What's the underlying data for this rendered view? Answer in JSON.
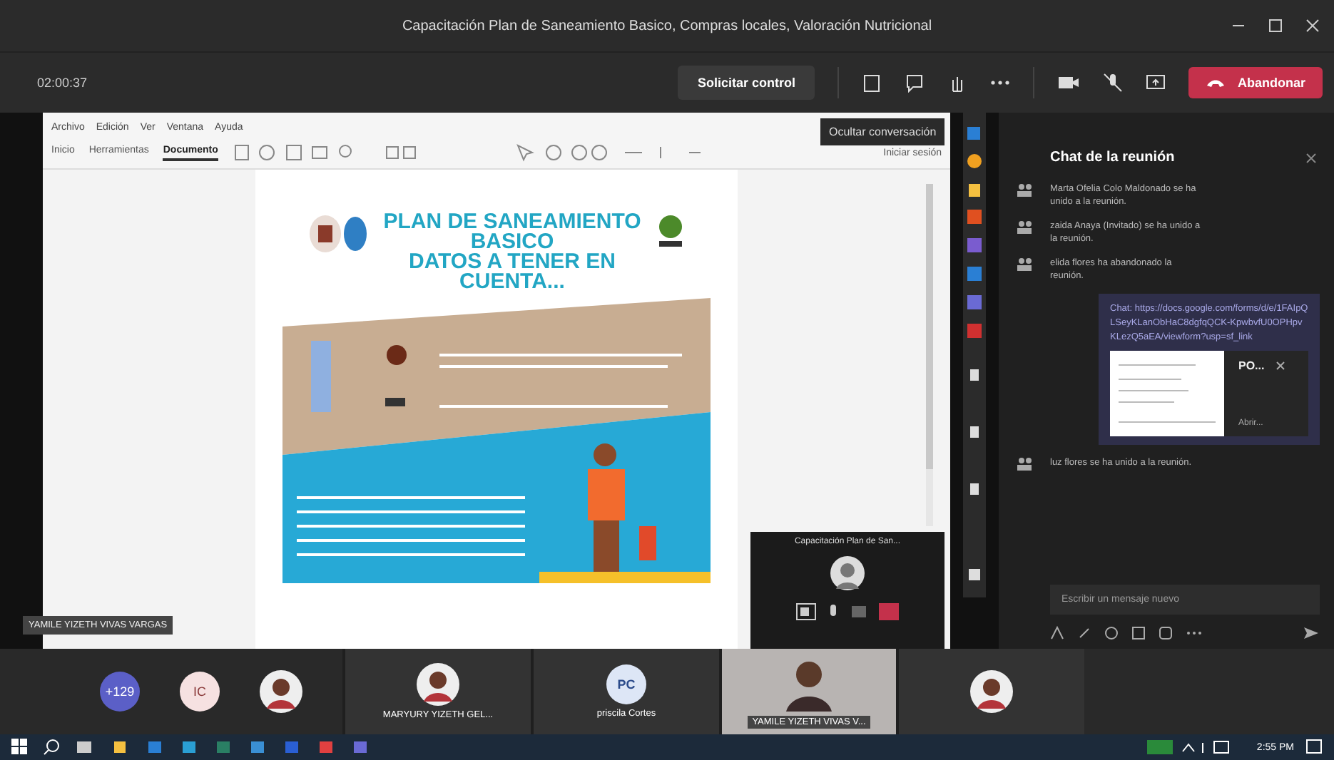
{
  "window": {
    "title": "Capacitación Plan de Saneamiento Basico, Compras locales, Valoración Nutricional"
  },
  "toolbar": {
    "timer": "02:00:37",
    "request_control": "Solicitar control",
    "leave": "Abandonar"
  },
  "tooltip": "Ocultar conversación",
  "viewer": {
    "menu": [
      "Archivo",
      "Edición",
      "Ver",
      "Ventana",
      "Ayuda"
    ],
    "tabs": [
      {
        "label": "Inicio",
        "selected": false
      },
      {
        "label": "Herramientas",
        "selected": false
      },
      {
        "label": "Documento",
        "selected": true
      }
    ],
    "sign_in": "Iniciar sesión"
  },
  "poster": {
    "title": [
      "PLAN DE SANEAMIENTO",
      "BASICO",
      "DATOS A TENER EN",
      "CUENTA..."
    ]
  },
  "presenter_label": "YAMILE YIZETH VIVAS VARGAS",
  "mini_window": {
    "title": "Capacitación Plan de San..."
  },
  "chat": {
    "title": "Chat de la reunión",
    "messages": [
      {
        "kind": "system",
        "text": "Marta Ofelia Colo Maldonado se ha unido a la reunión."
      },
      {
        "kind": "system",
        "text": "zaida Anaya (Invitado) se ha unido a la reunión."
      },
      {
        "kind": "system",
        "text": "elida flores ha abandonado la reunión."
      },
      {
        "kind": "link",
        "text": "Chat: https://docs.google.com/forms/d/e/1FAIpQLSeyKLanObHaC8dgfqQCK-KpwbvfU0OPHpvKLezQ5aEA/viewform?usp=sf_link",
        "file": "PO...",
        "action": "Abrir..."
      },
      {
        "kind": "system",
        "text": "luz flores se ha unido a la reunión."
      }
    ],
    "placeholder": "Escribir un mensaje nuevo"
  },
  "participants": [
    {
      "kind": "count",
      "label": "+129"
    },
    {
      "kind": "initials",
      "label": "IC"
    },
    {
      "kind": "avatar"
    },
    {
      "kind": "tile",
      "name": "MARYURY YIZETH GEL..."
    },
    {
      "kind": "initials-tile",
      "label": "PC",
      "name": "priscila Cortes"
    },
    {
      "kind": "video",
      "name": "YAMILE YIZETH VIVAS V..."
    },
    {
      "kind": "tile"
    }
  ],
  "taskbar": {
    "time": "2:55 PM"
  }
}
